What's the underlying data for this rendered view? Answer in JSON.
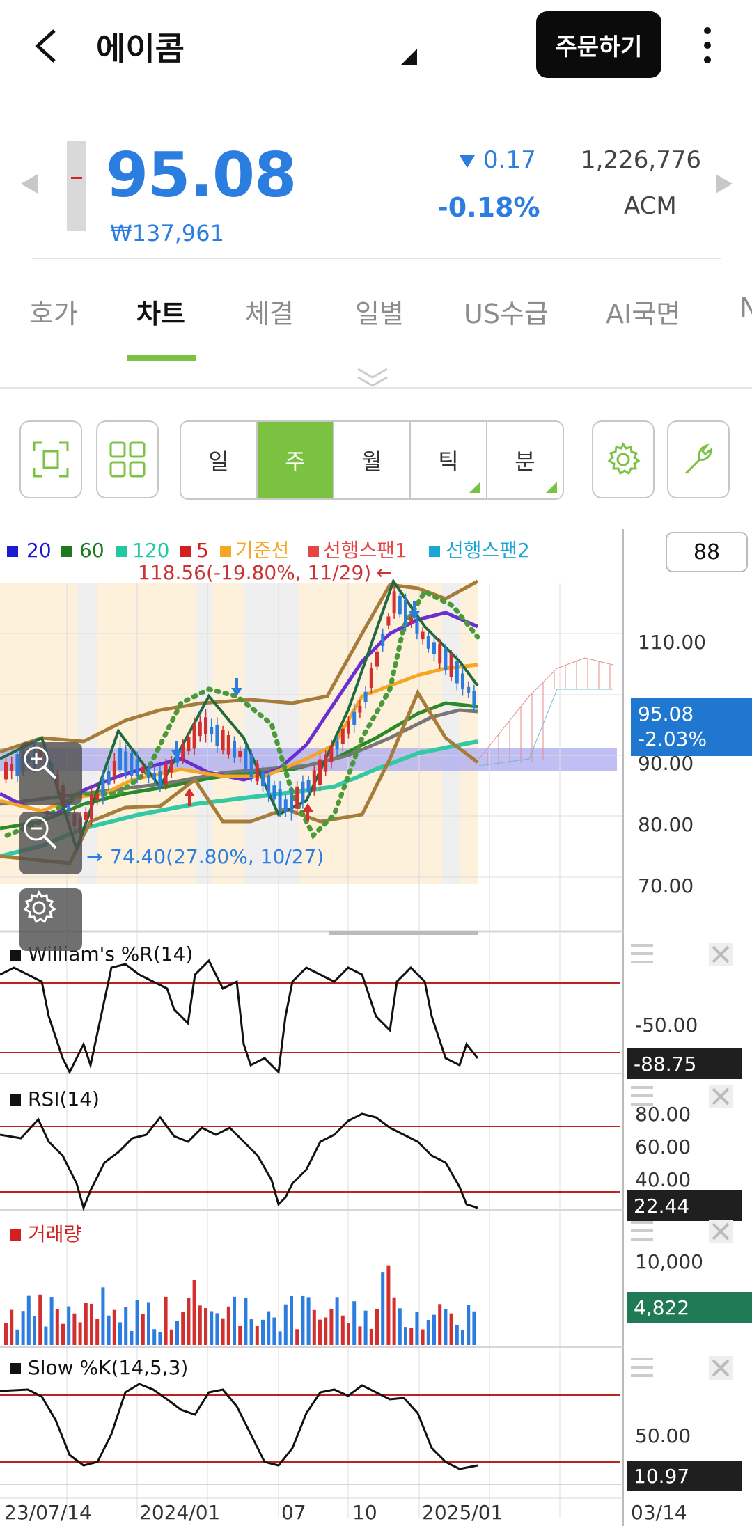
{
  "header": {
    "title": "에이콤",
    "order_label": "주문하기"
  },
  "quote": {
    "price": "95.08",
    "krw": "₩137,961",
    "change": "0.17",
    "change_pct": "-0.18%",
    "volume": "1,226,776",
    "ticker": "ACM"
  },
  "tabs": [
    {
      "label": "호가"
    },
    {
      "label": "차트"
    },
    {
      "label": "체결"
    },
    {
      "label": "일별"
    },
    {
      "label": "US수급"
    },
    {
      "label": "AI국면"
    },
    {
      "label": "N"
    }
  ],
  "periods": [
    {
      "label": "일"
    },
    {
      "label": "주"
    },
    {
      "label": "월"
    },
    {
      "label": "틱"
    },
    {
      "label": "분"
    }
  ],
  "chart": {
    "period_count": "88",
    "legend": [
      {
        "label": "20",
        "color": "#1a1ad6"
      },
      {
        "label": "60",
        "color": "#1f7a1f"
      },
      {
        "label": "120",
        "color": "#22c9a0"
      },
      {
        "label": "5",
        "color": "#d21f1f"
      },
      {
        "label": "기준선",
        "color": "#f5a623"
      },
      {
        "label": "선행스팬1",
        "color": "#e64545"
      },
      {
        "label": "선행스팬2",
        "color": "#1ba6d6"
      }
    ],
    "high_annot": "118.56(-19.80%, 11/29)",
    "low_annot": "74.40(27.80%, 10/27)",
    "price_ticks": [
      "110.00",
      "90.00",
      "80.00",
      "70.00"
    ],
    "current_price_badge": "95.08",
    "current_pct_badge": "-2.03%",
    "williams": {
      "title": "William's %R(14)",
      "tick": "-50.00",
      "value": "-88.75"
    },
    "rsi": {
      "title": "RSI(14)",
      "ticks": [
        "80.00",
        "60.00",
        "40.00"
      ],
      "value": "22.44"
    },
    "volume": {
      "title": "거래량",
      "tick": "10,000",
      "value": "4,822"
    },
    "slowk": {
      "title": "Slow %K(14,5,3)",
      "tick": "50.00",
      "value": "10.97"
    },
    "x_labels": [
      "23/07/14",
      "2024/01",
      "07",
      "10",
      "2025/01",
      "03/14"
    ]
  }
}
